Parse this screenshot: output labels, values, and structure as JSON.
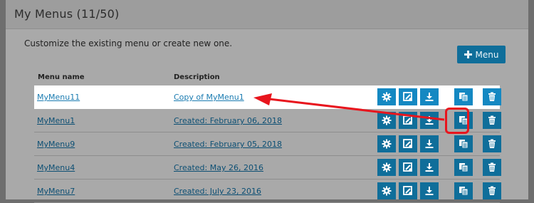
{
  "panel": {
    "title": "My Menus (11/50)",
    "description": "Customize the existing menu or create new one.",
    "add_button_label": "Menu"
  },
  "table": {
    "headers": {
      "name": "Menu name",
      "description": "Description"
    },
    "rows": [
      {
        "name": "MyMenu11",
        "description": "Copy of MyMenu1",
        "highlighted": true
      },
      {
        "name": "MyMenu1",
        "description": "Created: February 06, 2018",
        "highlighted": false
      },
      {
        "name": "MyMenu9",
        "description": "Created: February 05, 2018",
        "highlighted": false
      },
      {
        "name": "MyMenu4",
        "description": "Created: May 26, 2016",
        "highlighted": false
      },
      {
        "name": "MyMenu7",
        "description": "Created: July 23, 2016",
        "highlighted": false
      }
    ],
    "row_actions": [
      "gear-icon",
      "edit-icon",
      "download-icon",
      "copy-icon",
      "trash-icon"
    ]
  },
  "colors": {
    "button": "#0f6e9a",
    "button_highlight": "#1488c2",
    "annotation": "#e8151d"
  }
}
